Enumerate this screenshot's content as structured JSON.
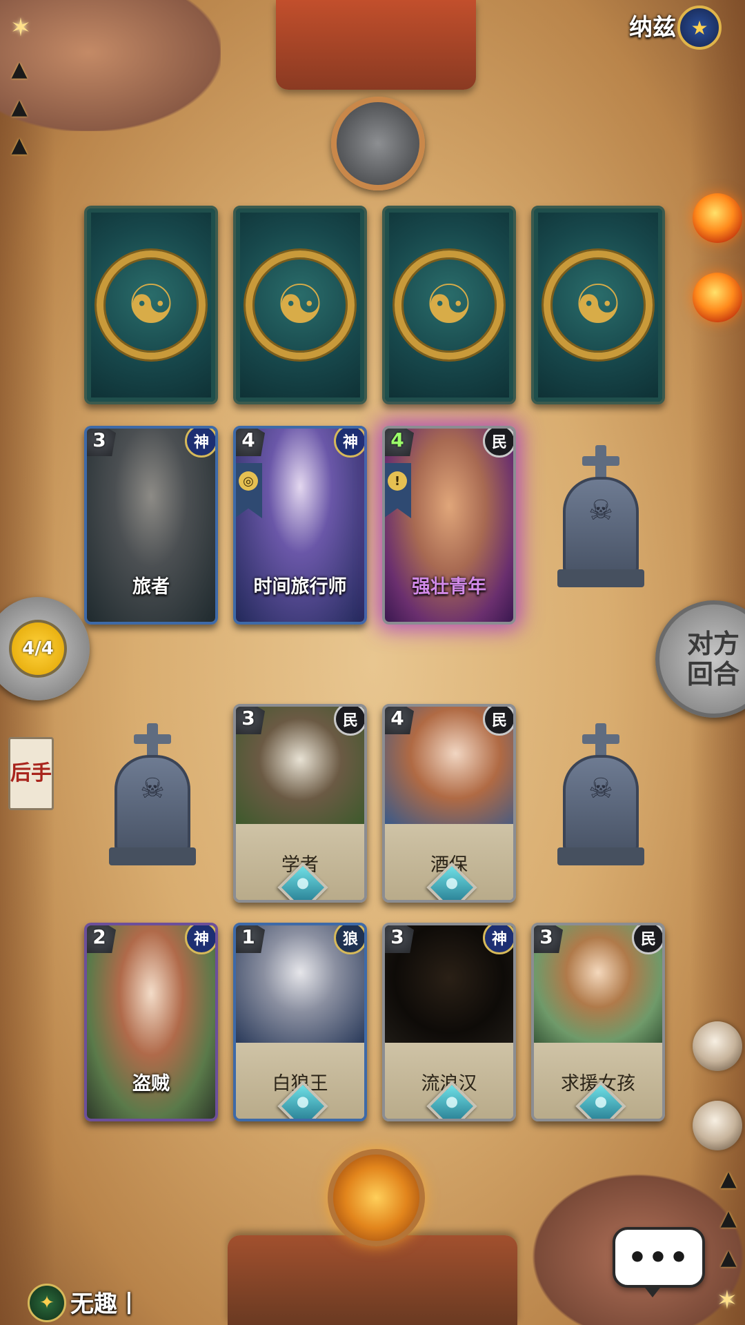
{
  "opponent": {
    "name": "纳兹",
    "avatar_icon": "book-icon"
  },
  "player": {
    "name": "无趣丨",
    "avatar_icon": "compass-icon"
  },
  "turn_counter": "4/4",
  "end_turn_label": "对方回合",
  "order_tag": "后手",
  "opponent_hand": [
    {
      "icon": "wolf-crest-icon"
    },
    {
      "icon": "wolf-crest-icon"
    },
    {
      "icon": "wolf-crest-icon"
    },
    {
      "icon": "wolf-crest-icon"
    }
  ],
  "opponent_board": [
    {
      "name": "旅者",
      "cost": "3",
      "faction": "神"
    },
    {
      "name": "时间旅行师",
      "cost": "4",
      "faction": "神"
    },
    {
      "name": "强壮青年",
      "cost": "4",
      "faction": "民"
    }
  ],
  "player_board": [
    {
      "name": "学者",
      "cost": "3",
      "faction": "民"
    },
    {
      "name": "酒保",
      "cost": "4",
      "faction": "民"
    }
  ],
  "player_hand": [
    {
      "name": "盗贼",
      "cost": "2",
      "faction": "神"
    },
    {
      "name": "白狼王",
      "cost": "1",
      "faction": "狼"
    },
    {
      "name": "流浪汉",
      "cost": "3",
      "faction": "神"
    },
    {
      "name": "求援女孩",
      "cost": "3",
      "faction": "民"
    }
  ],
  "colors": {
    "card_back": "#17474b",
    "gold": "#c99a3a",
    "fire": "#ff8a1c",
    "god_badge": "#1d2f72"
  }
}
